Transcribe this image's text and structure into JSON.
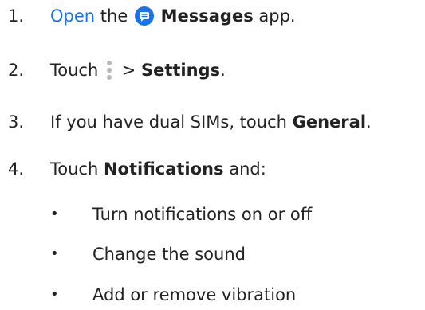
{
  "colors": {
    "link": "#1a73e8",
    "messages_icon": "#1a73e8"
  },
  "steps": [
    {
      "number": "1.",
      "link": "Open",
      "text_a": "the",
      "app_name": "Messages",
      "text_b": "app.",
      "icon": "messages-app-icon"
    },
    {
      "number": "2.",
      "text_a": "Touch",
      "icon": "more-options-icon",
      "separator": ">",
      "bold": "Settings",
      "text_b": "."
    },
    {
      "number": "3.",
      "text_a": "If you have dual SIMs, touch",
      "bold": "General",
      "text_b": "."
    },
    {
      "number": "4.",
      "text_a": "Touch",
      "bold": "Notifications",
      "text_b": "and:"
    }
  ],
  "bullets": [
    "Turn notifications on or off",
    "Change the sound",
    "Add or remove vibration"
  ]
}
